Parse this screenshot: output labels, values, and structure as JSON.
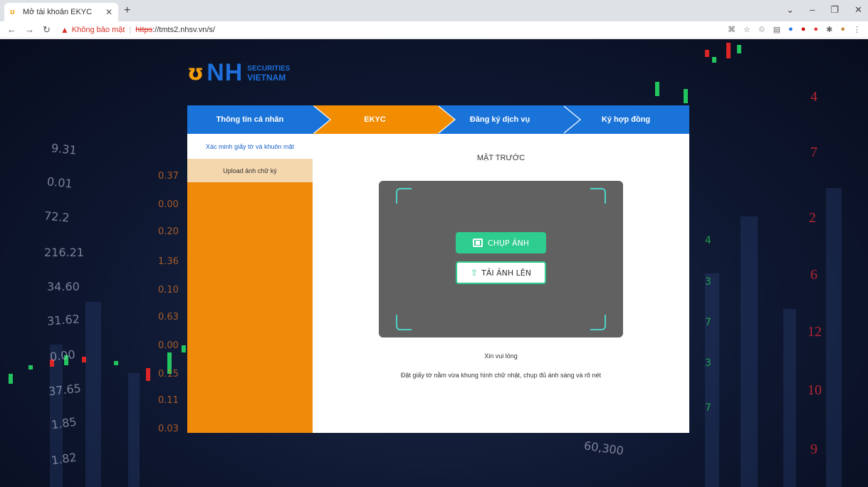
{
  "browser": {
    "tab_title": "Mở tài khoản EKYC",
    "warning_text": "Không bảo mật",
    "url_scheme": "https",
    "url_rest": "://tmts2.nhsv.vn/s/"
  },
  "logo": {
    "mark": "NH",
    "line1": "SECURITIES",
    "line2": "VIETNAM"
  },
  "steps": [
    "Thông tin cá nhân",
    "EKYC",
    "Đăng ký dịch vụ",
    "Ký hợp đồng"
  ],
  "sidebar": {
    "items": [
      "Xác minh giấy tờ và khuôn mặt",
      "Upload ảnh chữ ký"
    ]
  },
  "main": {
    "face_title": "MẶT TRƯỚC",
    "capture_label": "CHỤP ẢNH",
    "upload_label": "TẢI ẢNH LÊN",
    "hint_title": "Xin vui lòng",
    "hint_body": "Đặt giấy tờ nằm vừa khung hình chữ nhật, chụp đủ ánh sáng và rõ nét"
  },
  "background_numbers": {
    "left": [
      "9.31",
      "0.01",
      "72.2",
      "216.21",
      "34.60",
      "31.62",
      "0.00",
      "37.65",
      "1.85",
      "1.82"
    ],
    "orange": [
      "0.37",
      "0.00",
      "0.20",
      "1.36",
      "0.10",
      "0.63",
      "0.00",
      "0.15",
      "0.11",
      "0.03"
    ],
    "right": [
      "4",
      "7",
      "2",
      "6",
      "12",
      "10",
      "9"
    ],
    "green": [
      "4",
      "3",
      "7",
      "3",
      "7"
    ],
    "bottom": "60,300"
  },
  "colors": {
    "step_bar": "#1a73d9",
    "active": "#f28c00",
    "accent": "#2ecc8f"
  }
}
